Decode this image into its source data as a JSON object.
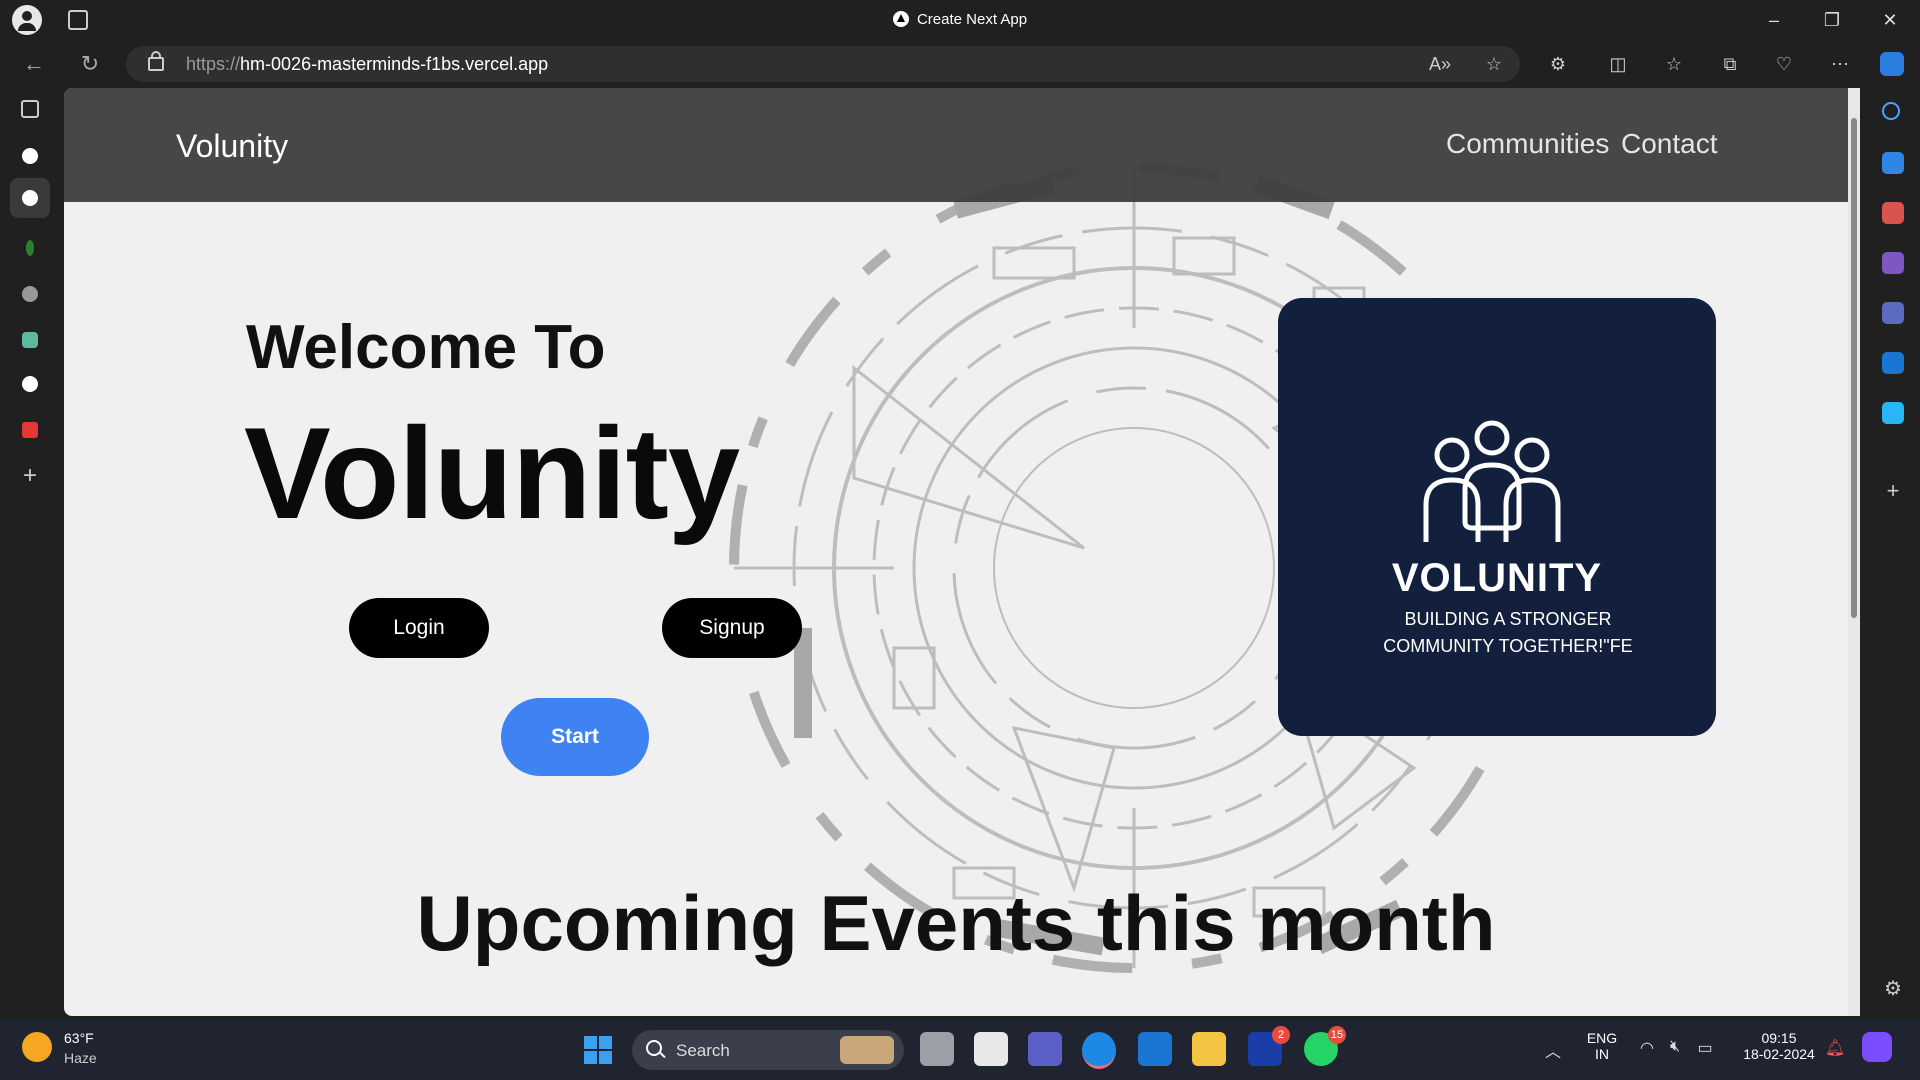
{
  "browser": {
    "tab_title": "Create Next App",
    "url_protocol": "https://",
    "url_host": "hm-0026-masterminds-f1bs.vercel.app"
  },
  "site": {
    "brand": "Volunity",
    "nav": [
      "Communities",
      "Contact"
    ],
    "welcome": "Welcome To",
    "title": "Volunity",
    "login_label": "Login",
    "signup_label": "Signup",
    "start_label": "Start",
    "card_title": "VOLUNITY",
    "card_tagline_1": "BUILDING A STRONGER",
    "card_tagline_2": "COMMUNITY TOGETHER!\"FE",
    "events_heading": "Upcoming Events this month",
    "colors": {
      "card_bg": "#12203e",
      "start_button": "#3f82f2",
      "navbar": "#3a3a3a"
    }
  },
  "taskbar": {
    "weather_temp": "63°F",
    "weather_desc": "Haze",
    "search_label": "Search",
    "lang_1": "ENG",
    "lang_2": "IN",
    "time": "09:15",
    "date": "18-02-2024",
    "badges": {
      "app_l": "2",
      "whatsapp": "15"
    }
  }
}
